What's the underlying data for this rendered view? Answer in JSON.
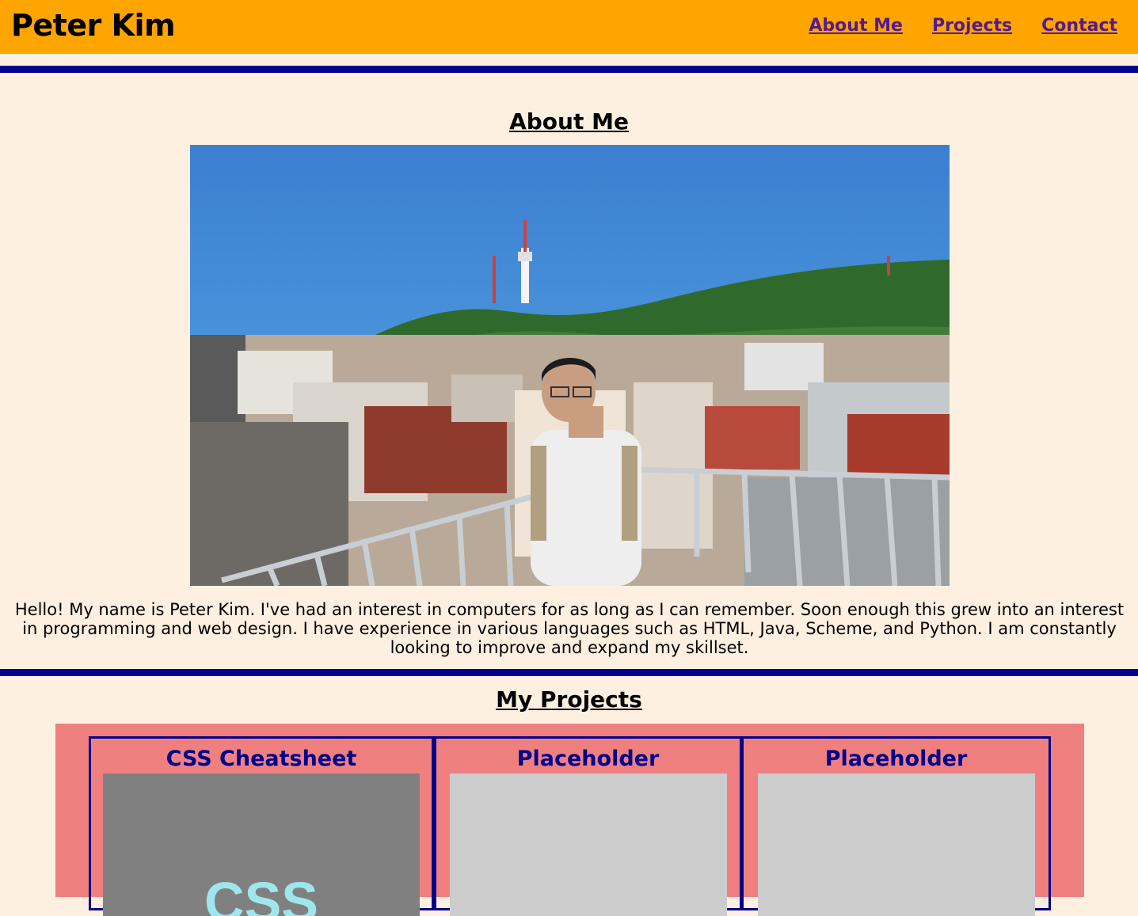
{
  "header": {
    "site_title": "Peter Kim",
    "nav": [
      "About Me",
      "Projects",
      "Contact"
    ]
  },
  "about": {
    "title": "About Me",
    "photo_icon": "portrait-photo",
    "bio": "Hello! My name is Peter Kim. I've had an interest in computers for as long as I can remember. Soon enough this grew into an interest in programming and web design. I have experience in various languages such as HTML, Java, Scheme, and Python. I am constantly looking to improve and expand my skillset."
  },
  "projects": {
    "title": "My Projects",
    "cards": [
      {
        "title": "CSS Cheatsheet",
        "thumb_text": "CSS"
      },
      {
        "title": "Placeholder"
      },
      {
        "title": "Placeholder"
      }
    ]
  },
  "colors": {
    "header_bg": "#ffa500",
    "page_bg": "#fdf0e0",
    "rule": "#00008b",
    "projects_bg": "#f08080",
    "card_border": "#00008b",
    "link": "#551a8b"
  }
}
